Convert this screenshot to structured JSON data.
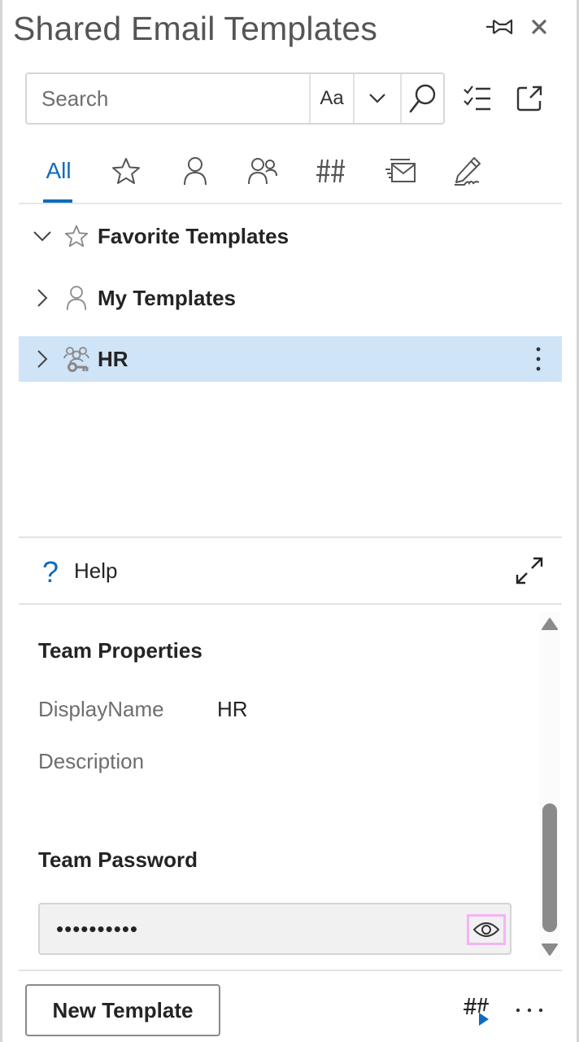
{
  "app": {
    "title": "Shared Email Templates"
  },
  "header": {
    "pin_icon": "pin-icon",
    "close_icon": "close-icon"
  },
  "search": {
    "placeholder": "Search",
    "value": "",
    "match_case_label": "Aa",
    "options_icon": "chevron-down-icon",
    "search_icon": "search-icon"
  },
  "toolbar": {
    "select_icon": "checklist-icon",
    "popout_icon": "popout-icon"
  },
  "tabs": [
    {
      "label": "All",
      "icon": null,
      "active": true
    },
    {
      "label": "",
      "icon": "star-icon",
      "active": false
    },
    {
      "label": "",
      "icon": "person-icon",
      "active": false
    },
    {
      "label": "",
      "icon": "people-icon",
      "active": false
    },
    {
      "label": "",
      "icon": "macros-icon",
      "active": false
    },
    {
      "label": "",
      "icon": "mail-send-icon",
      "active": false
    },
    {
      "label": "",
      "icon": "signature-icon",
      "active": false
    }
  ],
  "tree": [
    {
      "label": "Favorite Templates",
      "icon": "star-icon",
      "expanded": true,
      "selected": false
    },
    {
      "label": "My Templates",
      "icon": "person-icon",
      "expanded": false,
      "selected": false
    },
    {
      "label": "HR",
      "icon": "team-key-icon",
      "expanded": false,
      "selected": true
    }
  ],
  "help": {
    "label": "Help",
    "icon_glyph": "?",
    "expand_icon": "expand-icon"
  },
  "team_properties": {
    "title": "Team Properties",
    "fields": [
      {
        "label": "DisplayName",
        "value": "HR"
      },
      {
        "label": "Description",
        "value": ""
      }
    ],
    "password": {
      "title": "Team Password",
      "masked_value": "••••••••••",
      "reveal_icon": "eye-icon"
    }
  },
  "footer": {
    "new_template_label": "New Template",
    "macro_icon": "insert-macro-icon",
    "more_icon": "more-horizontal-icon"
  },
  "colors": {
    "accent": "#0f6cbd",
    "selected_row": "#cfe4f6",
    "focus_outline": "#f5b3f5"
  }
}
